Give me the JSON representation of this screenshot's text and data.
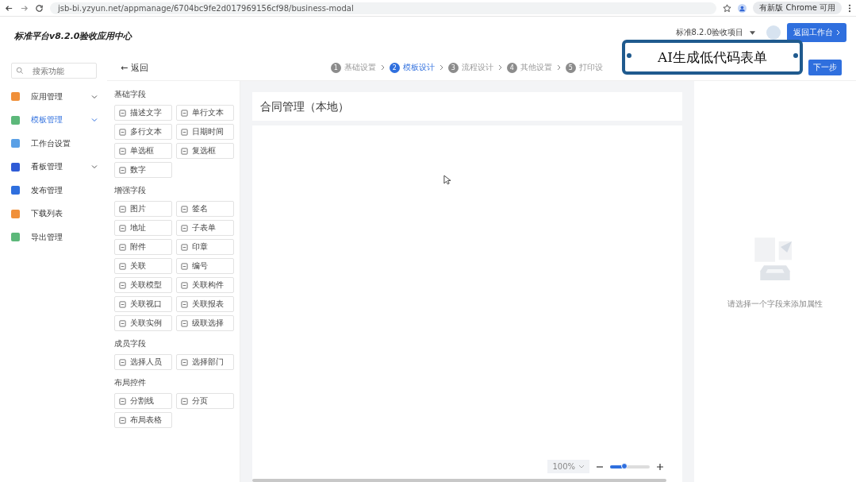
{
  "browser": {
    "url": "jsb-bi.yzyun.net/appmanage/6704bc9fe2d017969156cf98/business-modal",
    "update_notice": "有新版 Chrome 可用"
  },
  "header": {
    "title": "标准平台v8.2.0验收应用中心",
    "project": "标准8.2.0验收项目",
    "back_button": "返回工作台"
  },
  "sidebar": {
    "search_placeholder": "搜索功能",
    "items": [
      {
        "label": "应用管理",
        "color": "#f0903a",
        "expandable": true,
        "selected": false
      },
      {
        "label": "模板管理",
        "color": "#5cb87a",
        "expandable": true,
        "selected": true
      },
      {
        "label": "工作台设置",
        "color": "#5aa0e6",
        "expandable": false,
        "selected": false
      },
      {
        "label": "看板管理",
        "color": "#2f5bd6",
        "expandable": true,
        "selected": false
      },
      {
        "label": "发布管理",
        "color": "#2f6fde",
        "expandable": false,
        "selected": false
      },
      {
        "label": "下载列表",
        "color": "#f0903a",
        "expandable": false,
        "selected": false
      },
      {
        "label": "导出管理",
        "color": "#5cb87a",
        "expandable": false,
        "selected": false
      }
    ]
  },
  "topbar": {
    "back": "← 返回",
    "steps": [
      {
        "number": "1",
        "label": "基础设置",
        "selected": false
      },
      {
        "number": "2",
        "label": "模板设计",
        "selected": true
      },
      {
        "number": "3",
        "label": "流程设计",
        "selected": false
      },
      {
        "number": "4",
        "label": "其他设置",
        "selected": false
      },
      {
        "number": "5",
        "label": "打印设",
        "selected": false
      }
    ],
    "next_button": "下一步"
  },
  "palette": [
    {
      "title": "基础字段",
      "items": [
        "描述文字",
        "单行文本",
        "多行文本",
        "日期时间",
        "单选框",
        "复选框",
        "数字"
      ]
    },
    {
      "title": "增强字段",
      "items": [
        "图片",
        "签名",
        "地址",
        "子表单",
        "附件",
        "印章",
        "关联",
        "编号",
        "关联模型",
        "关联构件",
        "关联视口",
        "关联报表",
        "关联实例",
        "级联选择"
      ]
    },
    {
      "title": "成员字段",
      "items": [
        "选择人员",
        "选择部门"
      ]
    },
    {
      "title": "布局控件",
      "items": [
        "分割线",
        "分页",
        "布局表格"
      ]
    }
  ],
  "canvas": {
    "title": "合同管理（本地）",
    "zoom": {
      "value": "100%",
      "level": 0.35
    }
  },
  "properties": {
    "empty_text": "请选择一个字段来添加属性"
  },
  "caption": "AI生成低代码表单"
}
